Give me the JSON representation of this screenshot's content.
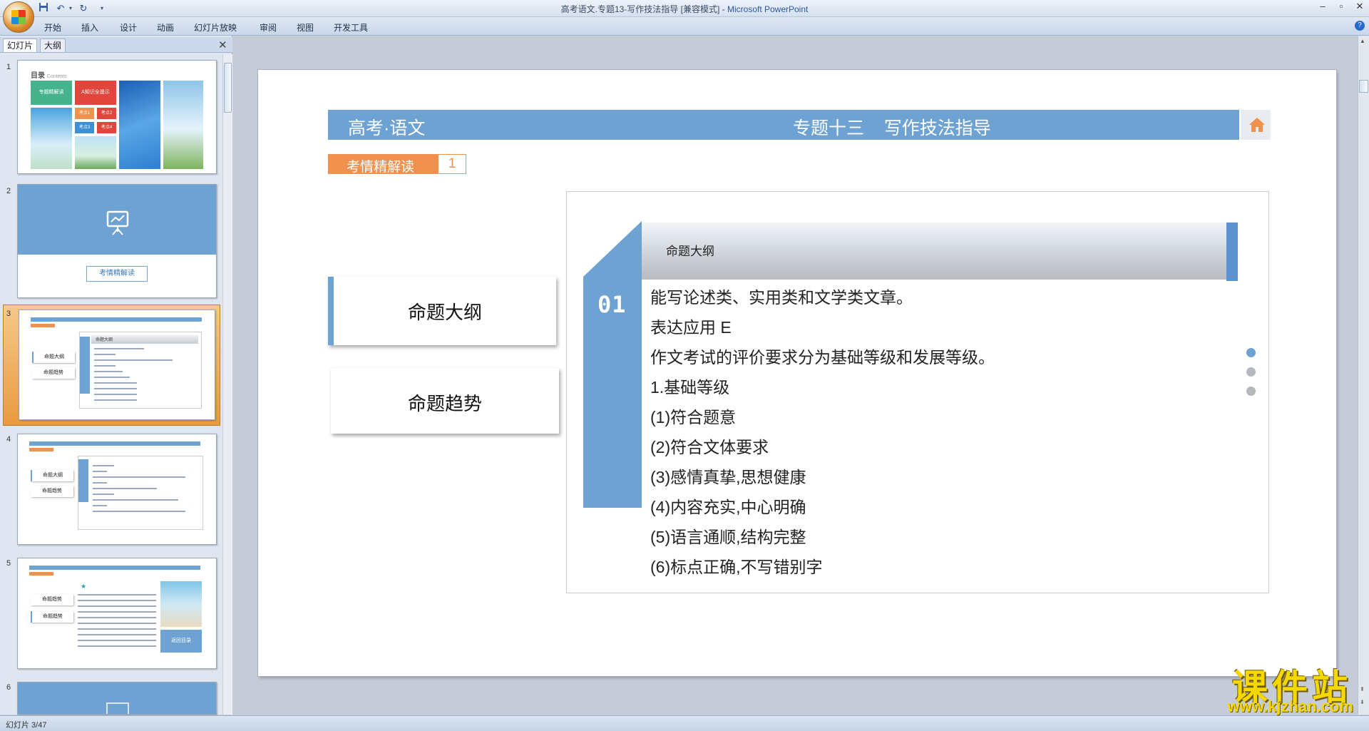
{
  "window": {
    "title_doc": "高考语文.专题13-写作技法指导 [兼容模式] - ",
    "title_app": "Microsoft PowerPoint"
  },
  "ribbon": {
    "tabs": [
      "开始",
      "插入",
      "设计",
      "动画",
      "幻灯片放映",
      "审阅",
      "视图",
      "开发工具"
    ]
  },
  "panel": {
    "tabs": [
      "幻灯片",
      "大纲"
    ],
    "slide_numbers": [
      "1",
      "2",
      "3",
      "4",
      "5",
      "6"
    ]
  },
  "thumbs": {
    "t1": {
      "title": "目录",
      "subtitle": "Contents",
      "tile1": "专题精解读",
      "tile2": "A知识全提示",
      "tile3": "考点1",
      "tile4": "考点2",
      "tile5": "考点3",
      "tile6": "考点4"
    },
    "t2": {
      "button": "考情精解读"
    },
    "t3": {
      "header": "命题大纲",
      "item1": "命题大纲",
      "item2": "命题趋势"
    },
    "t4": {
      "item1": "命题大纲",
      "item2": "命题趋势"
    },
    "t5": {
      "item1": "命题趋势",
      "item2": "命题趋势",
      "button": "返回目录"
    }
  },
  "slide": {
    "header_left": "高考·语文",
    "header_right": "专题十三    写作技法指导",
    "section_label": "考情精解读",
    "section_number": "1",
    "nav_items": [
      "命题大纲",
      "命题趋势"
    ],
    "panel_number": "01",
    "panel_title": "命题大纲",
    "body_lines": [
      "能写论述类、实用类和文学类文章。",
      "表达应用 E",
      "作文考试的评价要求分为基础等级和发展等级。",
      "1.基础等级",
      "(1)符合题意",
      "(2)符合文体要求",
      "(3)感情真挚,思想健康",
      "(4)内容充实,中心明确",
      "(5)语言通顺,结构完整",
      "(6)标点正确,不写错别字"
    ]
  },
  "status": {
    "text": "幻灯片 3/47"
  },
  "watermark": {
    "line1": "课件站",
    "line2": "www.kjzhan.com"
  },
  "colors": {
    "accent_blue": "#6ea2d2",
    "accent_orange": "#f0914d",
    "selection": "#e89b3f"
  }
}
